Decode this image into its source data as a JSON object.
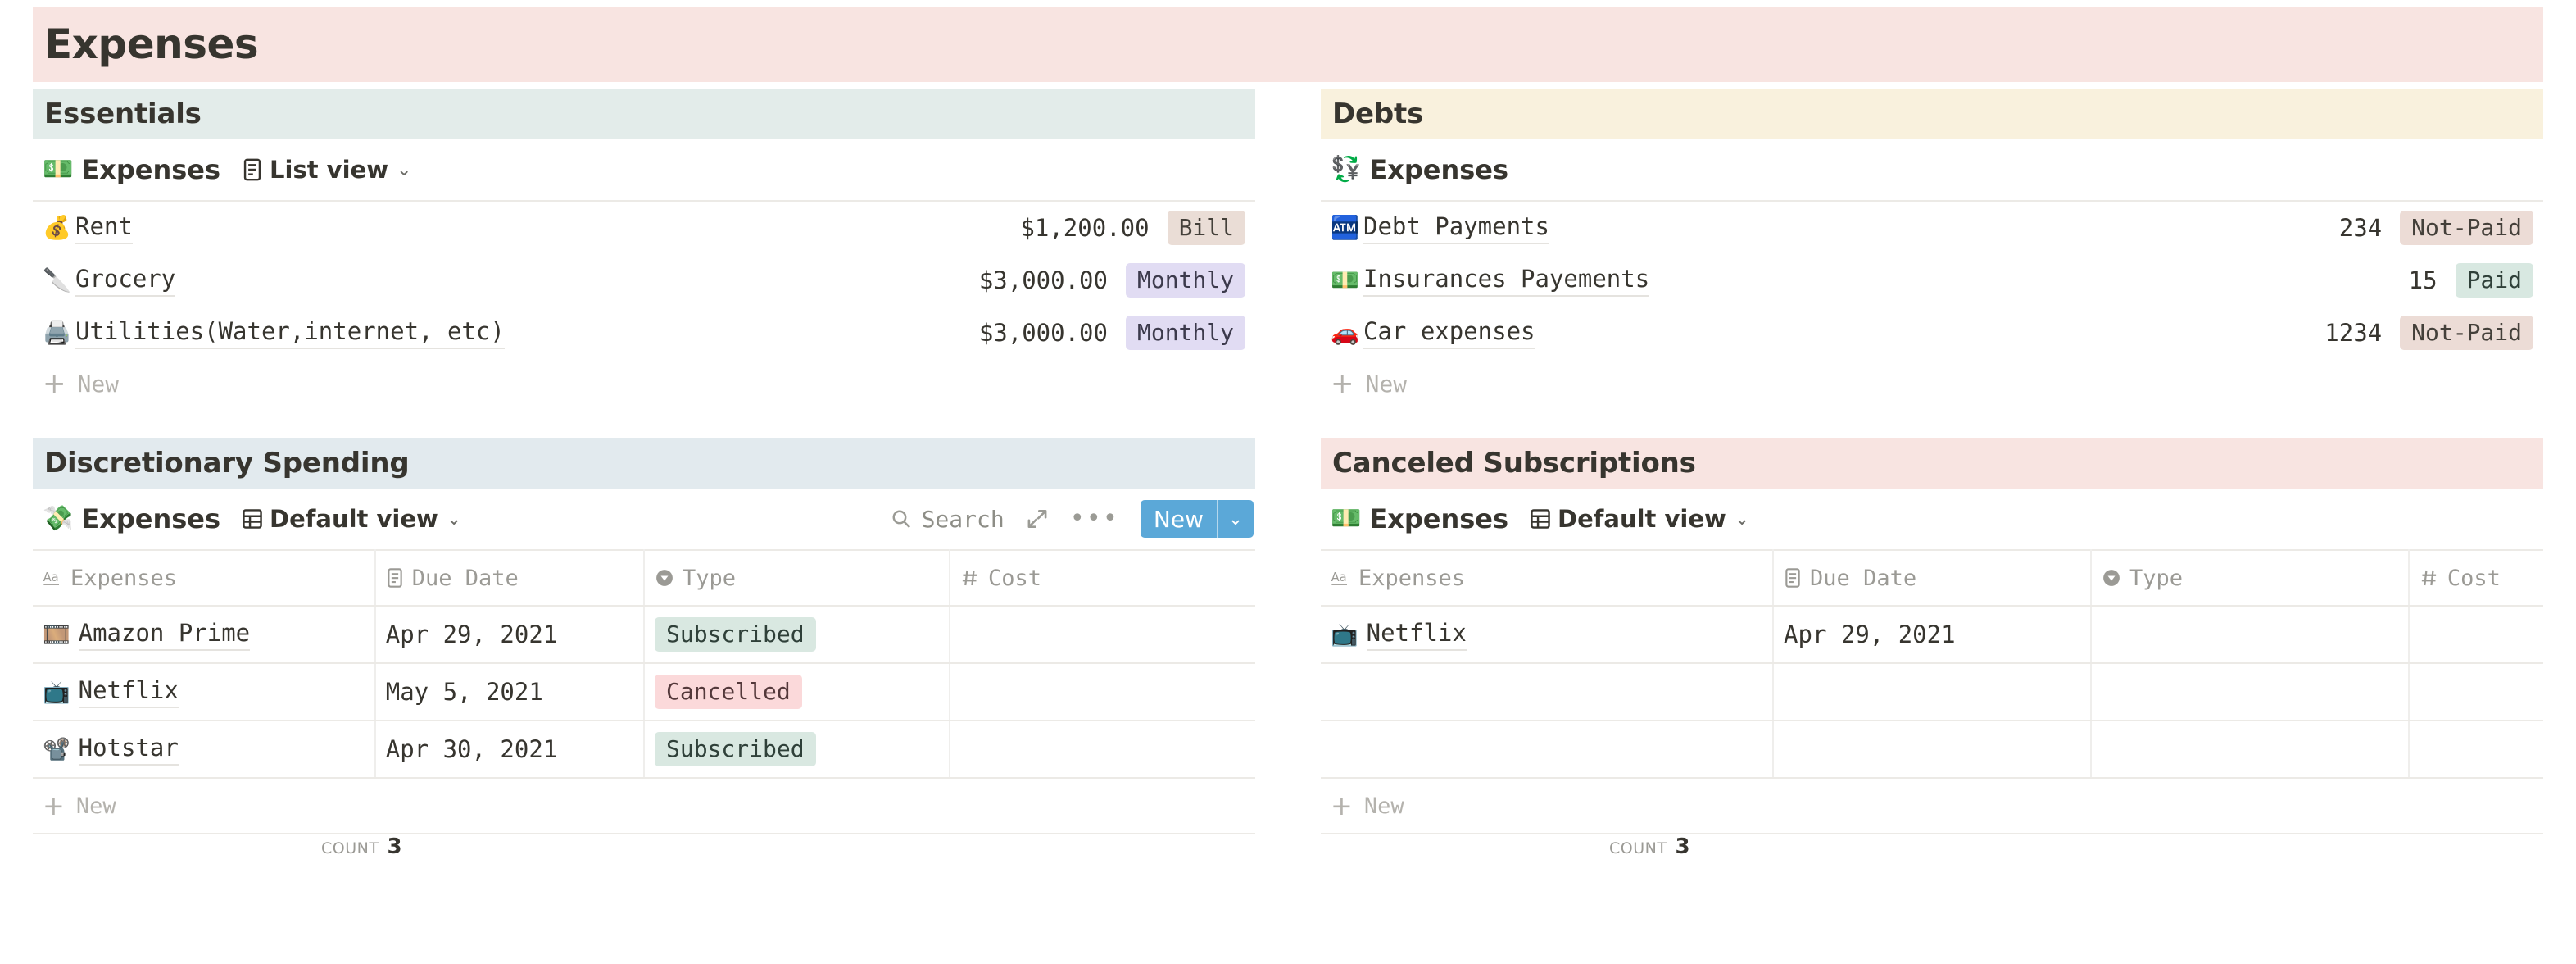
{
  "page": {
    "title": "Expenses",
    "title_banner_color": "#f8e4e1"
  },
  "toolbar": {
    "search_label": "Search",
    "expand_icon": "expand-icon",
    "more_icon": "more-options-icon",
    "new_label": "New",
    "new_dropdown_icon": "chevron-down-icon",
    "new_button_color": "#5ba8d8"
  },
  "common": {
    "new_row_label": "New",
    "count_label": "COUNT",
    "chevron": "⌄"
  },
  "sections": [
    {
      "id": "essentials",
      "title": "Essentials",
      "banner_color": "#e3ecea",
      "database": {
        "emoji": "💵",
        "emoji_name": "banknote-icon",
        "name": "Expenses",
        "view_label": "List view",
        "view_icon": "list-view-icon"
      },
      "type": "list",
      "rows": [
        {
          "emoji": "💰",
          "emoji_name": "money-bag-icon",
          "name": "Rent",
          "value": "$1,200.00",
          "tag": "Bill",
          "tag_style": "bill"
        },
        {
          "emoji": "🔪",
          "emoji_name": "kitchen-knife-icon",
          "name": "Grocery",
          "value": "$3,000.00",
          "tag": "Monthly",
          "tag_style": "monthly"
        },
        {
          "emoji": "🖨️",
          "emoji_name": "printer-icon",
          "name": "Utilities(Water,internet, etc)",
          "value": "$3,000.00",
          "tag": "Monthly",
          "tag_style": "monthly"
        }
      ]
    },
    {
      "id": "debts",
      "title": "Debts",
      "banner_color": "#f9f1dd",
      "database": {
        "emoji": "💱",
        "emoji_name": "currency-exchange-icon",
        "name": "Expenses",
        "view_label": "",
        "view_icon": ""
      },
      "type": "list",
      "rows": [
        {
          "emoji": "🏧",
          "emoji_name": "atm-sign-icon",
          "name": "Debt Payments",
          "value": "234",
          "tag": "Not-Paid",
          "tag_style": "notpaid"
        },
        {
          "emoji": "💵",
          "emoji_name": "banknote-icon",
          "name": "Insurances Payements",
          "value": "15",
          "tag": "Paid",
          "tag_style": "paid"
        },
        {
          "emoji": "🚗",
          "emoji_name": "car-icon",
          "name": "Car expenses",
          "value": "1234",
          "tag": "Not-Paid",
          "tag_style": "notpaid"
        }
      ]
    },
    {
      "id": "discretionary",
      "title": "Discretionary Spending",
      "banner_color": "#e2eaee",
      "database": {
        "emoji": "💸",
        "emoji_name": "money-with-wings-icon",
        "name": "Expenses",
        "view_label": "Default view",
        "view_icon": "table-view-icon"
      },
      "type": "table",
      "show_toolbar": true,
      "columns": [
        {
          "label": "Expenses",
          "icon": "text-type-icon"
        },
        {
          "label": "Due Date",
          "icon": "date-type-icon"
        },
        {
          "label": "Type",
          "icon": "select-type-icon"
        },
        {
          "label": "Cost",
          "icon": "number-type-icon"
        }
      ],
      "rows": [
        {
          "emoji": "🎞️",
          "emoji_name": "film-frames-icon",
          "name": "Amazon Prime",
          "due_date": "Apr 29, 2021",
          "type": "Subscribed",
          "type_style": "sub",
          "cost": ""
        },
        {
          "emoji": "📺",
          "emoji_name": "television-icon",
          "name": "Netflix",
          "due_date": "May 5, 2021",
          "type": "Cancelled",
          "type_style": "cxl",
          "cost": ""
        },
        {
          "emoji": "📽️",
          "emoji_name": "film-projector-icon",
          "name": "Hotstar",
          "due_date": "Apr 30, 2021",
          "type": "Subscribed",
          "type_style": "sub",
          "cost": ""
        }
      ],
      "count_value": "3"
    },
    {
      "id": "canceled",
      "title": "Canceled Subscriptions",
      "banner_color": "#f8e4e1",
      "database": {
        "emoji": "💵",
        "emoji_name": "banknote-icon",
        "name": "Expenses",
        "view_label": "Default view",
        "view_icon": "table-view-icon"
      },
      "type": "table",
      "show_toolbar": false,
      "columns": [
        {
          "label": "Expenses",
          "icon": "text-type-icon"
        },
        {
          "label": "Due Date",
          "icon": "date-type-icon"
        },
        {
          "label": "Type",
          "icon": "select-type-icon"
        },
        {
          "label": "Cost",
          "icon": "number-type-icon"
        }
      ],
      "rows": [
        {
          "emoji": "📺",
          "emoji_name": "television-icon",
          "name": "Netflix",
          "due_date": "Apr 29, 2021",
          "type": "",
          "type_style": "",
          "cost": ""
        },
        {
          "emoji": "",
          "emoji_name": "",
          "name": "",
          "due_date": "",
          "type": "",
          "type_style": "",
          "cost": ""
        },
        {
          "emoji": "",
          "emoji_name": "",
          "name": "",
          "due_date": "",
          "type": "",
          "type_style": "",
          "cost": ""
        }
      ],
      "count_value": "3"
    }
  ]
}
